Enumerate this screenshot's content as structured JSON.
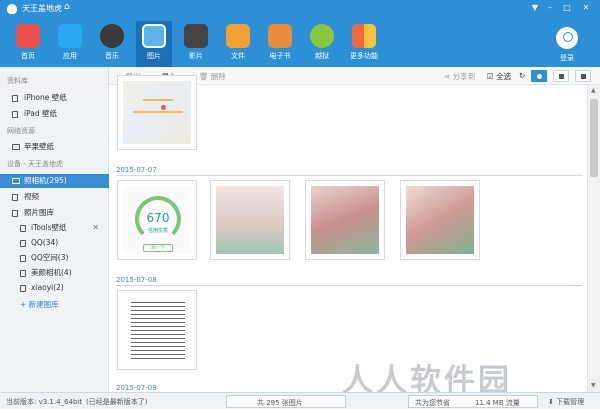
{
  "window": {
    "title": "天王盖地虎",
    "controls": [
      "▼",
      "–",
      "□",
      "✕"
    ]
  },
  "toolbar": {
    "items": [
      {
        "label": "首页",
        "icon": "home-icon",
        "color": "#e94e4e"
      },
      {
        "label": "应用",
        "icon": "appstore-icon",
        "color": "#2aa8f2"
      },
      {
        "label": "音乐",
        "icon": "music-icon",
        "color": "#3a3a3a"
      },
      {
        "label": "图片",
        "icon": "photo-icon",
        "color": "#5cb6e8"
      },
      {
        "label": "影片",
        "icon": "film-icon",
        "color": "#444444"
      },
      {
        "label": "文件",
        "icon": "file-icon",
        "color": "#f0a035"
      },
      {
        "label": "电子书",
        "icon": "ebook-icon",
        "color": "#e88b3a"
      },
      {
        "label": "越狱",
        "icon": "jailbreak-icon",
        "color": "#8cc63f"
      },
      {
        "label": "更多功能",
        "icon": "more-icon",
        "color": "#ef6b3b"
      }
    ],
    "active_label": "图片",
    "login_label": "登录"
  },
  "sidebar": {
    "section_library": "资料库",
    "library_items": [
      "iPhone 壁纸",
      "iPad 壁纸"
    ],
    "section_network": "网络资源",
    "network_items": [
      "苹果壁纸"
    ],
    "section_device": "设备 - 天王盖地虎",
    "device_items": [
      "照相机(295)",
      "视频",
      "照片图库"
    ],
    "album_items": [
      "iTools壁纸",
      "QQ(34)",
      "QQ空间(3)",
      "美颜相机(4)",
      "xiaoyi(2)"
    ],
    "add_album": "+ 新建图库",
    "close_glyph": "✕"
  },
  "actions": {
    "export": "导出",
    "import": "导入",
    "delete": "删除",
    "share": "分享到",
    "select_all": "全选",
    "refresh_glyph": "↻"
  },
  "content": {
    "groups": [
      {
        "date": "2015-07-07",
        "count": 4
      },
      {
        "date": "2015-07-08",
        "count": 1
      },
      {
        "date": "2015-07-09",
        "count": 0
      }
    ],
    "credit_score": "670",
    "credit_text": "信用优秀",
    "credit_button": "测一下"
  },
  "status": {
    "version": "当前版本: v3.1.4_64bit",
    "version_note": "(已经是最新版本了)",
    "photo_count": "共 295 张图片",
    "saved_prefix": "共为您节省",
    "saved_value": "11.4 MB 流量",
    "download_manager": "下载管理"
  },
  "watermark": "人人软件园"
}
